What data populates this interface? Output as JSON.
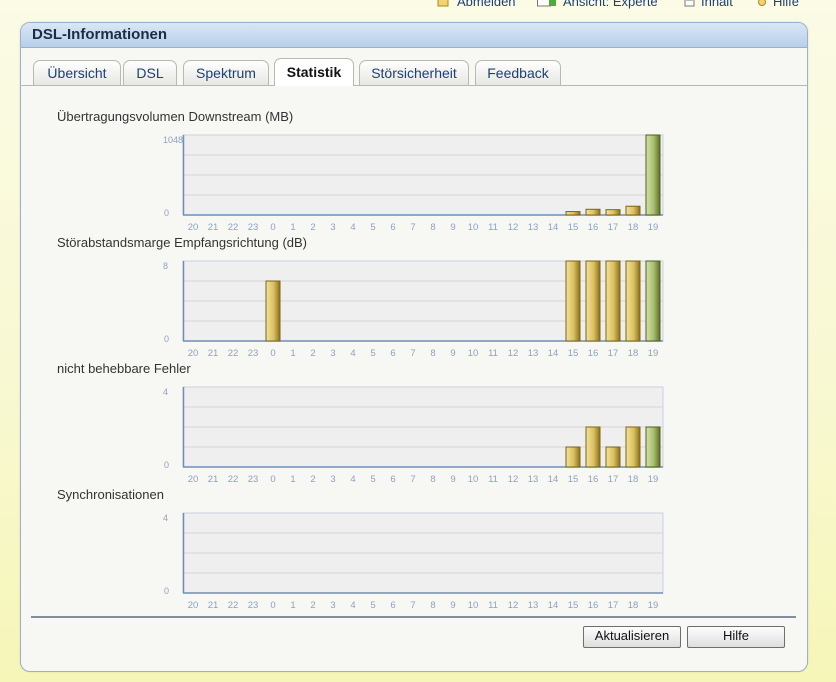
{
  "toolbar": {
    "logout_label": "Abmelden",
    "view_label": "Ansicht: Experte",
    "contents_label": "Inhalt",
    "help_label": "Hilfe"
  },
  "panel": {
    "title": "DSL-Informationen"
  },
  "tabs": [
    {
      "label": "Übersicht"
    },
    {
      "label": "DSL"
    },
    {
      "label": "Spektrum"
    },
    {
      "label": "Statistik",
      "active": true
    },
    {
      "label": "Störsicherheit"
    },
    {
      "label": "Feedback"
    }
  ],
  "colors": {
    "bar_fill_gold": "#d9c060",
    "bar_fill_green": "#a9be70",
    "grid_bg": "#efefef",
    "axis": "#6f8fb8",
    "tick_text": "#8da3bf"
  },
  "chart_data": [
    {
      "type": "bar",
      "title": "Übertragungsvolumen Downstream (MB)",
      "categories": [
        "20",
        "21",
        "22",
        "23",
        "0",
        "1",
        "2",
        "3",
        "4",
        "5",
        "6",
        "7",
        "8",
        "9",
        "10",
        "11",
        "12",
        "13",
        "14",
        "15",
        "16",
        "17",
        "18",
        "19"
      ],
      "values": [
        0,
        0,
        0,
        0,
        0,
        0,
        0,
        0,
        0,
        0,
        0,
        0,
        0,
        0,
        0,
        0,
        0,
        0,
        0,
        45,
        75,
        70,
        115,
        1048
      ],
      "ylim": [
        0,
        1048
      ],
      "y_ticks": [
        "0",
        "1048"
      ],
      "highlight_last": true,
      "grid": true
    },
    {
      "type": "bar",
      "title": "Störabstandsmarge Empfangsrichtung (dB)",
      "categories": [
        "20",
        "21",
        "22",
        "23",
        "0",
        "1",
        "2",
        "3",
        "4",
        "5",
        "6",
        "7",
        "8",
        "9",
        "10",
        "11",
        "12",
        "13",
        "14",
        "15",
        "16",
        "17",
        "18",
        "19"
      ],
      "values": [
        0,
        0,
        0,
        0,
        6,
        0,
        0,
        0,
        0,
        0,
        0,
        0,
        0,
        0,
        0,
        0,
        0,
        0,
        0,
        8,
        8,
        8,
        8,
        8
      ],
      "ylim": [
        0,
        8
      ],
      "y_ticks": [
        "0",
        "8"
      ],
      "highlight_last": true,
      "grid": true
    },
    {
      "type": "bar",
      "title": "nicht behebbare Fehler",
      "categories": [
        "20",
        "21",
        "22",
        "23",
        "0",
        "1",
        "2",
        "3",
        "4",
        "5",
        "6",
        "7",
        "8",
        "9",
        "10",
        "11",
        "12",
        "13",
        "14",
        "15",
        "16",
        "17",
        "18",
        "19"
      ],
      "values": [
        0,
        0,
        0,
        0,
        0,
        0,
        0,
        0,
        0,
        0,
        0,
        0,
        0,
        0,
        0,
        0,
        0,
        0,
        0,
        1,
        2,
        1,
        2,
        2
      ],
      "ylim": [
        0,
        4
      ],
      "y_ticks": [
        "0",
        "4"
      ],
      "highlight_last": true,
      "grid": true
    },
    {
      "type": "bar",
      "title": "Synchronisationen",
      "categories": [
        "20",
        "21",
        "22",
        "23",
        "0",
        "1",
        "2",
        "3",
        "4",
        "5",
        "6",
        "7",
        "8",
        "9",
        "10",
        "11",
        "12",
        "13",
        "14",
        "15",
        "16",
        "17",
        "18",
        "19"
      ],
      "values": [
        0,
        0,
        0,
        0,
        0,
        0,
        0,
        0,
        0,
        0,
        0,
        0,
        0,
        0,
        0,
        0,
        0,
        0,
        0,
        0,
        0,
        0,
        0,
        0
      ],
      "ylim": [
        0,
        4
      ],
      "y_ticks": [
        "0",
        "4"
      ],
      "highlight_last": true,
      "grid": true
    }
  ],
  "buttons": {
    "refresh_label": "Aktualisieren",
    "help_label": "Hilfe"
  }
}
